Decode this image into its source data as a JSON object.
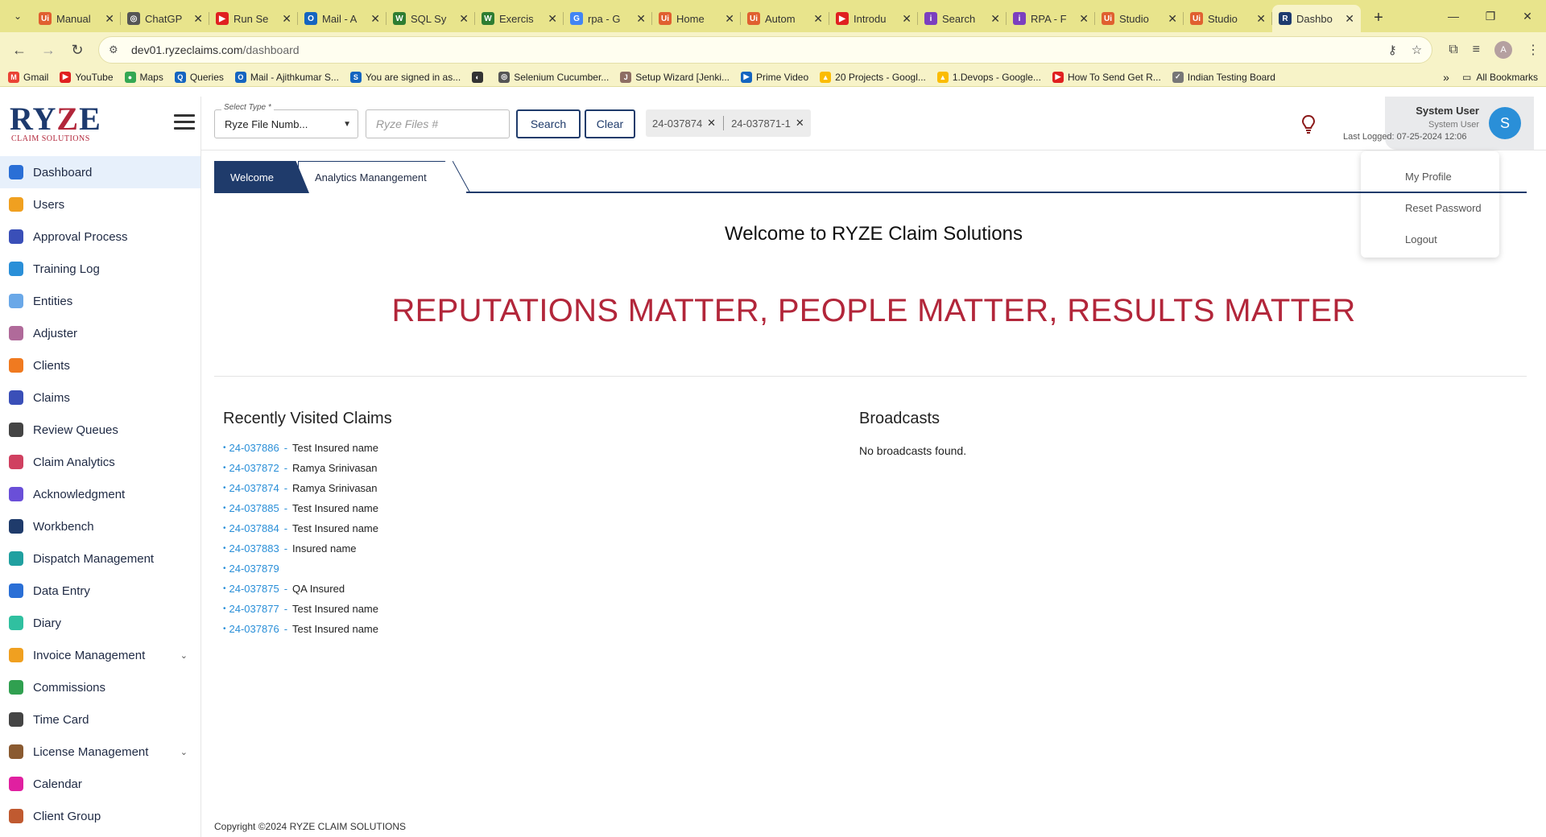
{
  "browser": {
    "tabs": [
      {
        "label": "Manual",
        "color": "#e06030",
        "glyph": "Ui"
      },
      {
        "label": "ChatGP",
        "color": "#555555",
        "glyph": "◎"
      },
      {
        "label": "Run Se",
        "color": "#e02020",
        "glyph": "▶"
      },
      {
        "label": "Mail - A",
        "color": "#1565c0",
        "glyph": "O"
      },
      {
        "label": "SQL Sy",
        "color": "#2e7d32",
        "glyph": "W"
      },
      {
        "label": "Exercis",
        "color": "#2e7d32",
        "glyph": "W"
      },
      {
        "label": "rpa - G",
        "color": "#4285f4",
        "glyph": "G"
      },
      {
        "label": "Home",
        "color": "#e06030",
        "glyph": "Ui"
      },
      {
        "label": "Autom",
        "color": "#e06030",
        "glyph": "Ui"
      },
      {
        "label": "Introdu",
        "color": "#e02020",
        "glyph": "▶"
      },
      {
        "label": "Search",
        "color": "#7b3fbf",
        "glyph": "i"
      },
      {
        "label": "RPA - F",
        "color": "#7b3fbf",
        "glyph": "i"
      },
      {
        "label": "Studio",
        "color": "#e06030",
        "glyph": "Ui"
      },
      {
        "label": "Studio",
        "color": "#e06030",
        "glyph": "Ui"
      },
      {
        "label": "Dashbo",
        "color": "#1d3a6e",
        "glyph": "R",
        "active": true
      }
    ],
    "url_host": "dev01.ryzeclaims.com",
    "url_path": "/dashboard",
    "profile_initial": "A",
    "bookmarks": [
      {
        "label": "Gmail",
        "color": "#ea4335",
        "glyph": "M"
      },
      {
        "label": "YouTube",
        "color": "#e02020",
        "glyph": "▶"
      },
      {
        "label": "Maps",
        "color": "#34a853",
        "glyph": "●"
      },
      {
        "label": "Queries",
        "color": "#1565c0",
        "glyph": "Q"
      },
      {
        "label": "Mail - Ajithkumar S...",
        "color": "#1565c0",
        "glyph": "O"
      },
      {
        "label": "You are signed in as...",
        "color": "#1565c0",
        "glyph": "S"
      },
      {
        "label": "",
        "color": "#333333",
        "glyph": "◐"
      },
      {
        "label": "Selenium Cucumber...",
        "color": "#555555",
        "glyph": "◎"
      },
      {
        "label": "Setup Wizard [Jenki...",
        "color": "#8d6e63",
        "glyph": "J"
      },
      {
        "label": "Prime Video",
        "color": "#1565c0",
        "glyph": "▶"
      },
      {
        "label": "20 Projects - Googl...",
        "color": "#fbbc04",
        "glyph": "▲"
      },
      {
        "label": "1.Devops - Google...",
        "color": "#fbbc04",
        "glyph": "▲"
      },
      {
        "label": "How To Send Get R...",
        "color": "#e02020",
        "glyph": "▶"
      },
      {
        "label": "Indian Testing Board",
        "color": "#777777",
        "glyph": "✓"
      }
    ],
    "all_bookmarks": "All Bookmarks"
  },
  "logo": {
    "name_a": "RY",
    "name_z": "Z",
    "name_b": "E",
    "subtitle": "CLAIM SOLUTIONS"
  },
  "sidebar": {
    "items": [
      {
        "label": "Dashboard",
        "icon": "dashboard-icon",
        "color": "#2a6fd6",
        "active": true
      },
      {
        "label": "Users",
        "icon": "users-icon",
        "color": "#f0a020"
      },
      {
        "label": "Approval Process",
        "icon": "approval-icon",
        "color": "#3a4fb8"
      },
      {
        "label": "Training Log",
        "icon": "training-icon",
        "color": "#2a8fd8"
      },
      {
        "label": "Entities",
        "icon": "entities-icon",
        "color": "#6aa8e8"
      },
      {
        "label": "Adjuster",
        "icon": "adjuster-icon",
        "color": "#b06a9a"
      },
      {
        "label": "Clients",
        "icon": "clients-icon",
        "color": "#f07a20"
      },
      {
        "label": "Claims",
        "icon": "claims-icon",
        "color": "#3a4fb8"
      },
      {
        "label": "Review Queues",
        "icon": "review-icon",
        "color": "#444444"
      },
      {
        "label": "Claim Analytics",
        "icon": "analytics-icon",
        "color": "#d04060"
      },
      {
        "label": "Acknowledgment",
        "icon": "acknowledgment-icon",
        "color": "#6a4fd8"
      },
      {
        "label": "Workbench",
        "icon": "workbench-icon",
        "color": "#1f3b6b"
      },
      {
        "label": "Dispatch Management",
        "icon": "dispatch-icon",
        "color": "#20a0a0"
      },
      {
        "label": "Data Entry",
        "icon": "data-entry-icon",
        "color": "#2a6fd6"
      },
      {
        "label": "Diary",
        "icon": "diary-icon",
        "color": "#30c0a0"
      },
      {
        "label": "Invoice Management",
        "icon": "invoice-icon",
        "color": "#f0a020",
        "caret": true
      },
      {
        "label": "Commissions",
        "icon": "commissions-icon",
        "color": "#30a050"
      },
      {
        "label": "Time Card",
        "icon": "time-card-icon",
        "color": "#444444"
      },
      {
        "label": "License Management",
        "icon": "license-icon",
        "color": "#8a5a30",
        "caret": true
      },
      {
        "label": "Calendar",
        "icon": "calendar-icon",
        "color": "#e020a0"
      },
      {
        "label": "Client Group",
        "icon": "client-group-icon",
        "color": "#c05a30"
      }
    ]
  },
  "topbar": {
    "select_label": "Select Type *",
    "select_value": "Ryze File Numb...",
    "input_placeholder": "Ryze Files #",
    "search_label": "Search",
    "clear_label": "Clear",
    "chips": [
      "24-037874",
      "24-037871-1"
    ]
  },
  "user": {
    "name": "System User",
    "role": "System User",
    "last_logged": "Last Logged: 07-25-2024 12:06",
    "initial": "S"
  },
  "user_menu": [
    "My Profile",
    "Reset Password",
    "Logout"
  ],
  "main": {
    "tabs": [
      "Welcome",
      "Analytics Manangement"
    ],
    "welcome_title": "Welcome to RYZE Claim Solutions",
    "slogan": "REPUTATIONS MATTER, PEOPLE MATTER, RESULTS MATTER",
    "recent_title": "Recently Visited Claims",
    "recent": [
      {
        "num": "24-037886",
        "name": "Test Insured name"
      },
      {
        "num": "24-037872",
        "name": "Ramya Srinivasan"
      },
      {
        "num": "24-037874",
        "name": "Ramya Srinivasan"
      },
      {
        "num": "24-037885",
        "name": "Test Insured name"
      },
      {
        "num": "24-037884",
        "name": "Test Insured name"
      },
      {
        "num": "24-037883",
        "name": "Insured name"
      },
      {
        "num": "24-037879",
        "name": ""
      },
      {
        "num": "24-037875",
        "name": "QA Insured"
      },
      {
        "num": "24-037877",
        "name": "Test Insured name"
      },
      {
        "num": "24-037876",
        "name": "Test Insured name"
      }
    ],
    "broadcasts_title": "Broadcasts",
    "broadcasts_empty": "No broadcasts found."
  },
  "footer": "Copyright ©2024 RYZE CLAIM SOLUTIONS"
}
